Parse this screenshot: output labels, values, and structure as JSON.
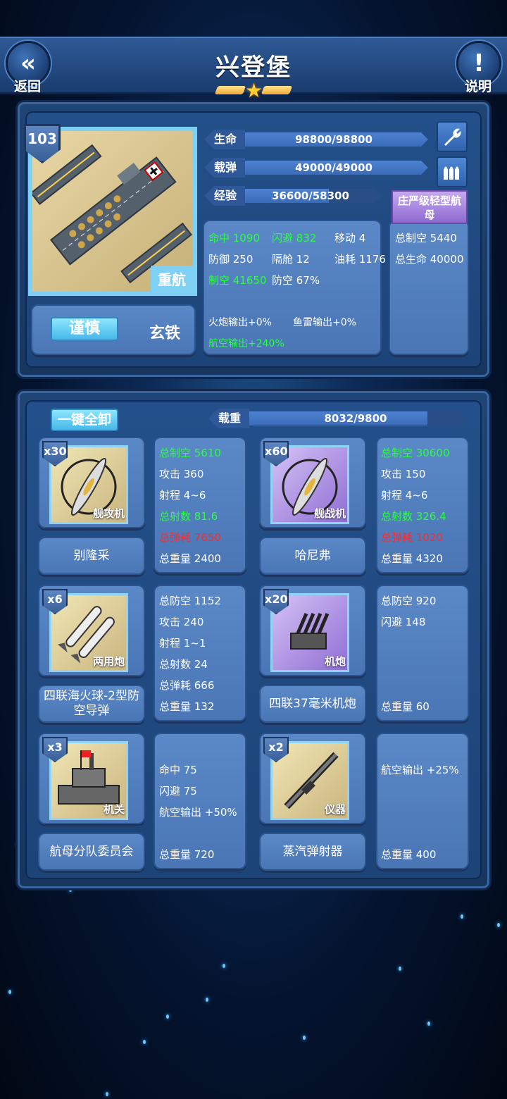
{
  "header": {
    "title": "兴登堡",
    "back_label": "返回",
    "help_label": "说明"
  },
  "ship": {
    "level": "103",
    "type_tag": "重航",
    "trait": "谨慎",
    "material": "玄铁",
    "class_name": "庄严级轻型航母",
    "bars": {
      "hp": {
        "label": "生命",
        "value": "98800/98800",
        "fraction": 1.0
      },
      "ammo": {
        "label": "载弹",
        "value": "49000/49000",
        "fraction": 1.0
      },
      "exp": {
        "label": "经验",
        "value": "36600/58300",
        "fraction": 0.628
      }
    },
    "stats": {
      "hit": "命中 1090",
      "evasion": "闪避 832",
      "move": "移动 4",
      "defense": "防御 250",
      "bulkhead": "隔舱 12",
      "fuel": "油耗 1176",
      "air_control": "制空 41650",
      "aa": "防空 67%",
      "gun_out": "火炮输出+0%",
      "torp_out": "鱼雷输出+0%",
      "air_out": "航空输出+240%"
    },
    "class_stats": {
      "total_air": "总制空 5440",
      "total_hp": "总生命 40000"
    }
  },
  "loadout": {
    "unload_all": "一键全卸",
    "capacity": {
      "label": "载重",
      "value": "8032/9800",
      "fraction": 0.82
    },
    "items": [
      {
        "qty": "x30",
        "tag": "舰攻机",
        "name": "别隆采",
        "stats": [
          {
            "text": "总制空 5610",
            "color": "green"
          },
          {
            "text": "攻击 360",
            "color": "white"
          },
          {
            "text": "射程 4~6",
            "color": "white"
          },
          {
            "text": "总射数 81.6",
            "color": "green"
          },
          {
            "text": "总弹耗 7650",
            "color": "red"
          },
          {
            "text": "总重量 2400",
            "color": "white"
          }
        ]
      },
      {
        "qty": "x60",
        "tag": "舰战机",
        "name": "哈尼弗",
        "stats": [
          {
            "text": "总制空 30600",
            "color": "green"
          },
          {
            "text": "攻击 150",
            "color": "white"
          },
          {
            "text": "射程 4~6",
            "color": "white"
          },
          {
            "text": "总射数 326.4",
            "color": "green"
          },
          {
            "text": "总弹耗 1020",
            "color": "red"
          },
          {
            "text": "总重量 4320",
            "color": "white"
          }
        ]
      },
      {
        "qty": "x6",
        "tag": "两用炮",
        "name": "四联海火球-2型防空导弹",
        "stats": [
          {
            "text": "总防空 1152",
            "color": "white"
          },
          {
            "text": "攻击 240",
            "color": "white"
          },
          {
            "text": "射程 1~1",
            "color": "white"
          },
          {
            "text": "总射数 24",
            "color": "white"
          },
          {
            "text": "总弹耗 666",
            "color": "white"
          },
          {
            "text": "总重量 132",
            "color": "white"
          }
        ]
      },
      {
        "qty": "x20",
        "tag": "机炮",
        "name": "四联37毫米机炮",
        "stats": [
          {
            "text": "总防空 920",
            "color": "white"
          },
          {
            "text": "闪避 148",
            "color": "white"
          },
          {
            "text": "",
            "color": "white"
          },
          {
            "text": "",
            "color": "white"
          },
          {
            "text": "",
            "color": "white"
          },
          {
            "text": "总重量 60",
            "color": "white"
          }
        ]
      },
      {
        "qty": "x3",
        "tag": "机关",
        "name": "航母分队委员会",
        "stats": [
          {
            "text": "",
            "color": "white"
          },
          {
            "text": "命中 75",
            "color": "white"
          },
          {
            "text": "闪避 75",
            "color": "white"
          },
          {
            "text": "航空输出 +50%",
            "color": "white"
          },
          {
            "text": "",
            "color": "white"
          },
          {
            "text": "总重量 720",
            "color": "white"
          }
        ]
      },
      {
        "qty": "x2",
        "tag": "仪器",
        "name": "蒸汽弹射器",
        "stats": [
          {
            "text": "",
            "color": "white"
          },
          {
            "text": "航空输出 +25%",
            "color": "white"
          },
          {
            "text": "",
            "color": "white"
          },
          {
            "text": "",
            "color": "white"
          },
          {
            "text": "",
            "color": "white"
          },
          {
            "text": "总重量 400",
            "color": "white"
          }
        ]
      }
    ]
  }
}
